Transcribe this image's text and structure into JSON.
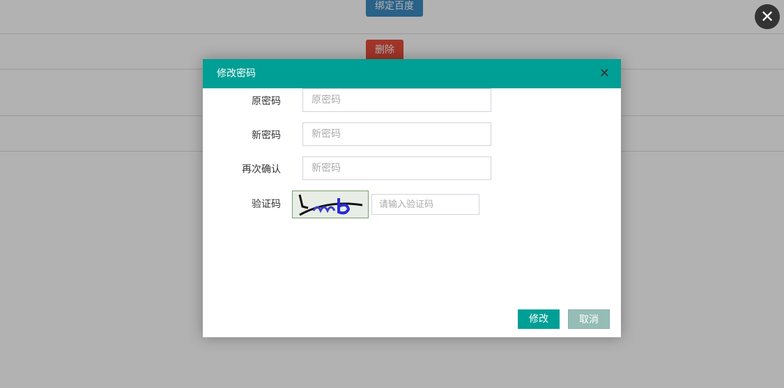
{
  "background": {
    "bind_baidu_button": "绑定百度",
    "delete_button": "删除"
  },
  "dialog": {
    "title": "修改密码",
    "fields": [
      {
        "label": "原密码",
        "placeholder": "原密码"
      },
      {
        "label": "新密码",
        "placeholder": "新密码"
      },
      {
        "label": "再次确认",
        "placeholder": "新密码"
      }
    ],
    "captcha": {
      "label": "验证码",
      "placeholder": "请输入验证码"
    },
    "confirm_button": "修改",
    "cancel_button": "取消"
  },
  "colors": {
    "header": "#009f95",
    "confirm": "#009f95",
    "cancel": "#95bdb6"
  }
}
